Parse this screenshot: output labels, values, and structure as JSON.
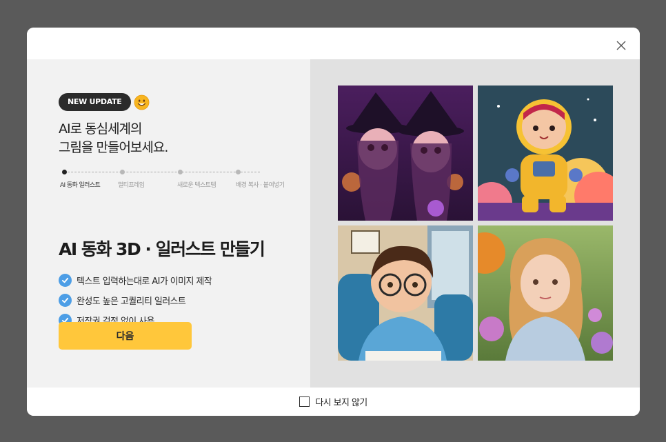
{
  "modal": {
    "badge": "NEW UPDATE",
    "headline_line1": "AI로 동심세계의",
    "headline_line2": "그림을 만들어보세요.",
    "steps": [
      {
        "label": "AI 동화 일러스트",
        "active": true
      },
      {
        "label": "멀티프레임",
        "active": false
      },
      {
        "label": "새로운 텍스트템",
        "active": false
      },
      {
        "label": "배경 복사 · 붙여넣기",
        "active": false
      }
    ],
    "title": "AI 동화 3D · 일러스트 만들기",
    "features": [
      "텍스트 입력하는대로 AI가 이미지 제작",
      "완성도 높은 고퀄리티 일러스트",
      "저작권 걱정 없이 사용"
    ],
    "next_button": "다음",
    "dont_show_again": "다시 보지 않기"
  },
  "icons": {
    "close": "close-icon",
    "emoji": "smiley-icon",
    "check": "check-circle-icon"
  },
  "colors": {
    "backdrop": "#5a5a5a",
    "accent_button": "#ffc73b",
    "check_blue": "#4d9ee6",
    "badge_bg": "#2b2b2b"
  }
}
